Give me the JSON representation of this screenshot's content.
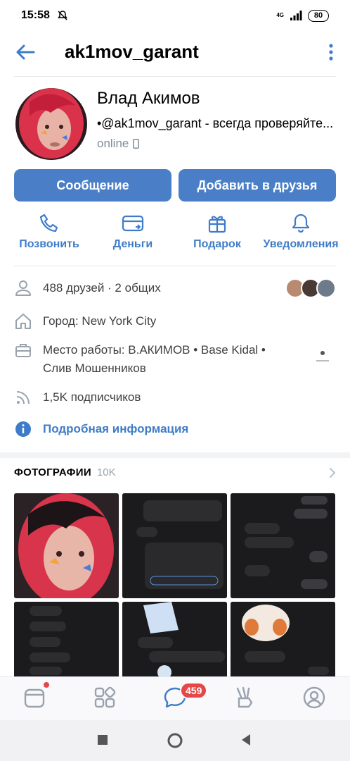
{
  "status_bar": {
    "time": "15:58",
    "network": "4G",
    "battery": "80"
  },
  "header": {
    "title": "ak1mov_garant"
  },
  "profile": {
    "name": "Влад Акимов",
    "status": "•@ak1mov_garant - всегда проверяйте...",
    "online": "online"
  },
  "buttons": {
    "message": "Сообщение",
    "add_friend": "Добавить в друзья"
  },
  "actions": [
    {
      "label": "Позвонить",
      "icon": "phone-icon"
    },
    {
      "label": "Деньги",
      "icon": "money-icon"
    },
    {
      "label": "Подарок",
      "icon": "gift-icon"
    },
    {
      "label": "Уведомления",
      "icon": "bell-icon"
    }
  ],
  "info": {
    "friends": "488 друзей · 2 общих",
    "city": "Город: New York City",
    "work": "Место работы: В.АКИМОВ • Base Kidal •\nСлив Мошенников",
    "followers": "1,5K подписчиков",
    "details": "Подробная информация"
  },
  "photos": {
    "heading": "ФОТОГРАФИИ",
    "count": "10K"
  },
  "tabbar": {
    "items": [
      "news-icon",
      "services-icon",
      "messages-icon",
      "clips-icon",
      "profile-icon"
    ],
    "messages_badge": "459"
  },
  "colors": {
    "accent": "#4a7fc8",
    "link": "#3f7cc8",
    "badge": "#e64646"
  }
}
